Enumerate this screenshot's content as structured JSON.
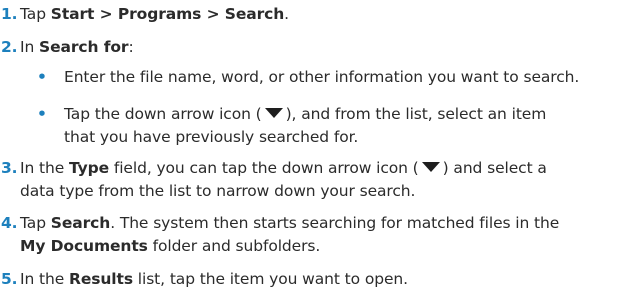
{
  "steps": [
    {
      "number": "1.",
      "pre": "Tap ",
      "bold": "Start > Programs > Search",
      "post": "."
    },
    {
      "number": "2.",
      "pre": "In ",
      "bold": "Search for",
      "post": ":",
      "bullets": [
        {
          "marker": "•",
          "text": "Enter the file name, word, or other information you want to search."
        },
        {
          "marker": "•",
          "pre": "Tap the down arrow icon (",
          "post": "), and from the list, select an item",
          "line2": "that you have previously searched for."
        }
      ]
    },
    {
      "number": "3.",
      "pre": "In the ",
      "bold": "Type",
      "mid": " field, you can tap the down arrow icon (",
      "post": ") and select a",
      "line2": "data type from the list to narrow down your search."
    },
    {
      "number": "4.",
      "pre": "Tap ",
      "bold": "Search",
      "post": ". The system then starts searching for matched files in the",
      "line2_bold": "My Documents",
      "line2_post": " folder and subfolders."
    },
    {
      "number": "5.",
      "pre": "In the ",
      "bold": "Results",
      "post": " list, tap the item you want to open."
    }
  ],
  "icons": {
    "down_arrow": "down-arrow-icon"
  },
  "colors": {
    "accent": "#1d80bd",
    "text": "#2b2b2b"
  }
}
